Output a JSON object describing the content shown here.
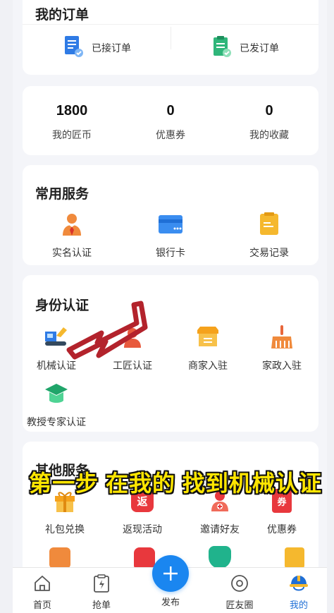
{
  "orders": {
    "title": "我的订单",
    "received_label": "已接订单",
    "sent_label": "已发订单"
  },
  "stats": [
    {
      "value": "1800",
      "label": "我的匠币"
    },
    {
      "value": "0",
      "label": "优惠券"
    },
    {
      "value": "0",
      "label": "我的收藏"
    }
  ],
  "common_services": {
    "title": "常用服务",
    "items": [
      {
        "label": "实名认证",
        "icon": "verified-person-icon"
      },
      {
        "label": "银行卡",
        "icon": "bank-card-icon"
      },
      {
        "label": "交易记录",
        "icon": "transaction-record-icon"
      }
    ]
  },
  "identity": {
    "title": "身份认证",
    "items": [
      {
        "label": "机械认证",
        "icon": "machinery-icon"
      },
      {
        "label": "工匠认证",
        "icon": "craftsman-icon"
      },
      {
        "label": "商家入驻",
        "icon": "merchant-store-icon"
      },
      {
        "label": "家政入驻",
        "icon": "housekeeping-broom-icon"
      },
      {
        "label": "教授专家认证",
        "icon": "graduation-cap-icon"
      }
    ]
  },
  "other_services": {
    "title": "其他服务",
    "items": [
      {
        "label": "礼包兑换",
        "icon": "gift-icon"
      },
      {
        "label": "返现活动",
        "icon": "cashback-icon",
        "badge": "返"
      },
      {
        "label": "邀请好友",
        "icon": "invite-friend-icon"
      },
      {
        "label": "优惠券",
        "icon": "coupon-icon",
        "badge": "券"
      }
    ]
  },
  "caption": "第一步 在我的 找到机械认证",
  "tabbar": [
    {
      "label": "首页",
      "icon": "home-icon"
    },
    {
      "label": "抢单",
      "icon": "grab-order-icon"
    },
    {
      "label": "发布",
      "icon": "plus-icon"
    },
    {
      "label": "匠友圈",
      "icon": "circle-icon"
    },
    {
      "label": "我的",
      "icon": "helmet-icon",
      "active": true
    }
  ],
  "colors": {
    "accent": "#1a86f0",
    "active_tab": "#1f6fd6",
    "caption": "#ffe600",
    "arrow": "#b3232c"
  }
}
